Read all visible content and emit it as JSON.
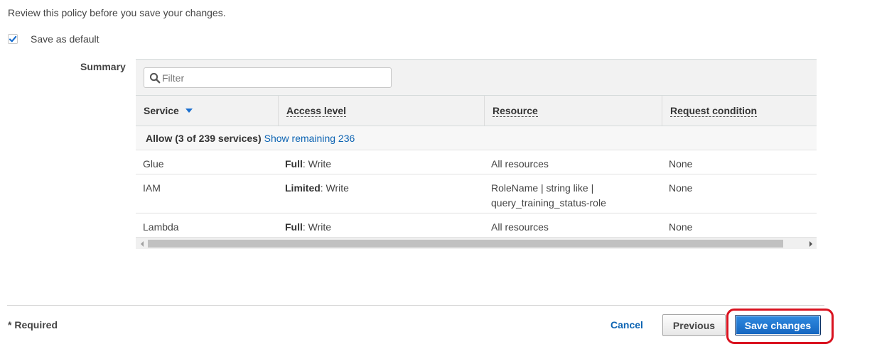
{
  "intro_text": "Review this policy before you save your changes.",
  "save_default": {
    "label": "Save as default",
    "checked": true
  },
  "summary": {
    "label": "Summary",
    "filter_placeholder": "Filter",
    "columns": {
      "service": "Service",
      "access_level": "Access level",
      "resource": "Resource",
      "request_condition": "Request condition"
    },
    "group": {
      "label": "Allow (3 of 239 services)",
      "link": "Show remaining 236"
    },
    "rows": [
      {
        "service": "Glue",
        "access_strong": "Full",
        "access_rest": ": Write",
        "resource": "All resources",
        "resource_line2": "",
        "condition": "None"
      },
      {
        "service": "IAM",
        "access_strong": "Limited",
        "access_rest": ": Write",
        "resource": "RoleName | string like |",
        "resource_line2": "query_training_status-role",
        "condition": "None"
      },
      {
        "service": "Lambda",
        "access_strong": "Full",
        "access_rest": ": Write",
        "resource": "All resources",
        "resource_line2": "",
        "condition": "None"
      }
    ]
  },
  "footer": {
    "required": "* Required",
    "cancel": "Cancel",
    "previous": "Previous",
    "save": "Save changes"
  },
  "colors": {
    "link": "#0d64b3",
    "primary": "#1a73d0",
    "highlight": "#d9121f"
  }
}
